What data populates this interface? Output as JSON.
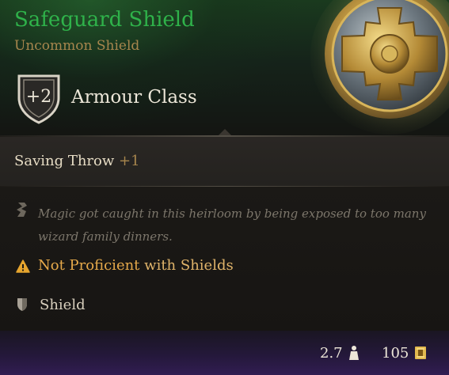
{
  "item": {
    "name": "Safeguard Shield",
    "rarity": "Uncommon Shield"
  },
  "armour": {
    "value": "+2",
    "label": "Armour Class"
  },
  "saving_throw": {
    "label": "Saving Throw",
    "value": "+1"
  },
  "description": "Magic got caught in this heirloom by being exposed to too many wizard family dinners.",
  "proficiency_warning": {
    "prefix": "Not Proficient",
    "suffix": "with Shields"
  },
  "item_type": "Shield",
  "footer": {
    "weight": "2.7",
    "price": "105"
  },
  "colors": {
    "name_green": "#2fb24a",
    "rarity_tan": "#a7864d",
    "warning_orange": "#e6a94a",
    "footer_purple": "#311d52"
  },
  "icons": {
    "armour_class": "shield-badge-icon",
    "description": "quill-icon",
    "warning": "warning-triangle-icon",
    "type": "shield-icon",
    "weight": "weight-icon",
    "price": "gold-coin-icon"
  }
}
